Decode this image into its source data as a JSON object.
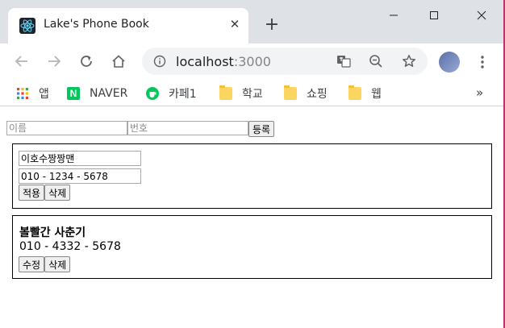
{
  "browser": {
    "tab": {
      "title": "Lake's Phone Book",
      "close_glyph": "✕"
    },
    "new_tab_glyph": "+",
    "address": {
      "host": "localhost",
      "port": ":3000"
    },
    "bookmarks": [
      {
        "label": "앱",
        "icon": "apps-grid-icon"
      },
      {
        "label": "NAVER",
        "icon": "naver-icon",
        "icon_text": "N"
      },
      {
        "label": "카페1",
        "icon": "cafe-icon"
      },
      {
        "label": "학교",
        "icon": "folder-icon"
      },
      {
        "label": "쇼핑",
        "icon": "folder-icon"
      },
      {
        "label": "웹",
        "icon": "folder-icon"
      }
    ],
    "bookmarks_more": "»"
  },
  "app": {
    "form": {
      "name_placeholder": "이름",
      "phone_placeholder": "번호",
      "submit_label": "등록"
    },
    "contacts": [
      {
        "mode": "edit",
        "name": "이호수짱짱맨",
        "phone": "010 - 1234 - 5678",
        "primary_label": "적용",
        "delete_label": "삭제"
      },
      {
        "mode": "view",
        "name": "볼빨간 사춘기",
        "phone": "010 - 4332 - 5678",
        "primary_label": "수정",
        "delete_label": "삭제"
      }
    ]
  },
  "colors": {
    "tabstrip": "#dee1e6",
    "omnibox": "#f1f3f4",
    "naver_green": "#03c75a",
    "folder_yellow": "#fcd462",
    "window_edge": "#c0326a"
  }
}
